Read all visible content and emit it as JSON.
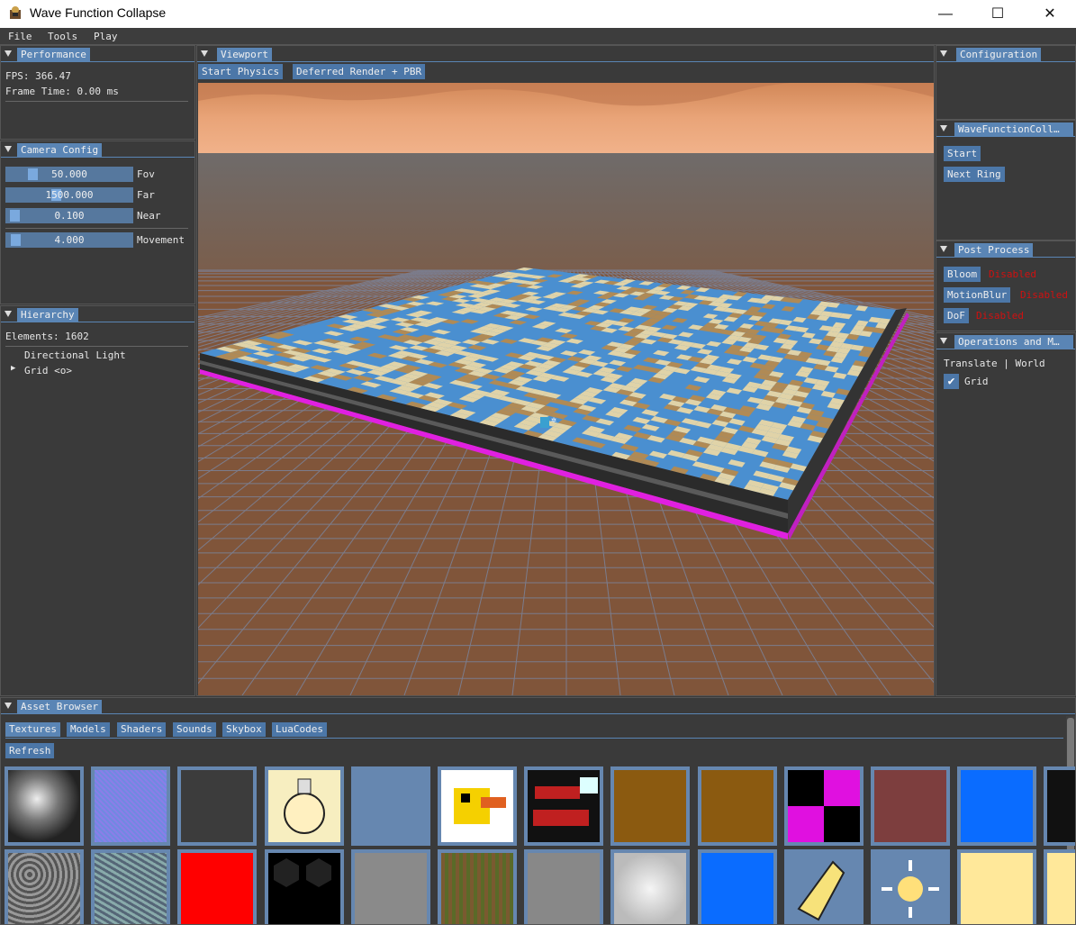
{
  "window": {
    "title": "Wave Function Collapse",
    "minimize": "—",
    "maximize": "☐",
    "close": "✕"
  },
  "menu": {
    "file": "File",
    "tools": "Tools",
    "play": "Play"
  },
  "performance": {
    "tab": "Performance",
    "fps": "FPS: 366.47",
    "frame_time": "Frame Time: 0.00 ms"
  },
  "camera": {
    "tab": "Camera Config",
    "sliders": [
      {
        "value": "50.000",
        "label": "Fov",
        "level": 0.18
      },
      {
        "value": "1500.000",
        "label": "Far",
        "level": 0.38
      },
      {
        "value": "0.100",
        "label": "Near",
        "level": 0.02
      },
      {
        "value": "4.000",
        "label": "Movement",
        "level": 0.03
      }
    ]
  },
  "hierarchy": {
    "tab": "Hierarchy",
    "elements": "Elements: 1602",
    "items": [
      "Directional Light",
      "Grid <o>"
    ],
    "expand_arrow": "▶"
  },
  "viewport": {
    "tab": "Viewport",
    "start_physics": "Start Physics",
    "render_mode": "Deferred Render + PBR"
  },
  "configuration": {
    "tab": "Configuration"
  },
  "wfc": {
    "tab": "WaveFunctionColl…",
    "start": "Start",
    "next_ring": "Next Ring"
  },
  "post_process": {
    "tab": "Post Process",
    "items": [
      {
        "label": "Bloom",
        "status": "Disabled"
      },
      {
        "label": "MotionBlur",
        "status": "Disabled"
      },
      {
        "label": "DoF",
        "status": "Disabled"
      }
    ]
  },
  "operations": {
    "tab": "Operations and M…",
    "translate": "Translate | World",
    "grid_label": "Grid",
    "grid_checked": true
  },
  "assets": {
    "tab": "Asset Browser",
    "tabs": [
      "Textures",
      "Models",
      "Shaders",
      "Sounds",
      "Skybox",
      "LuaCodes"
    ],
    "refresh": "Refresh"
  },
  "colors": {
    "accent": "#5a85b5",
    "water": "#4a8fd0",
    "sand": "#e0d3a8",
    "dirt": "#b08a55",
    "disabled": "#d01010",
    "magenta": "#e020e0"
  }
}
